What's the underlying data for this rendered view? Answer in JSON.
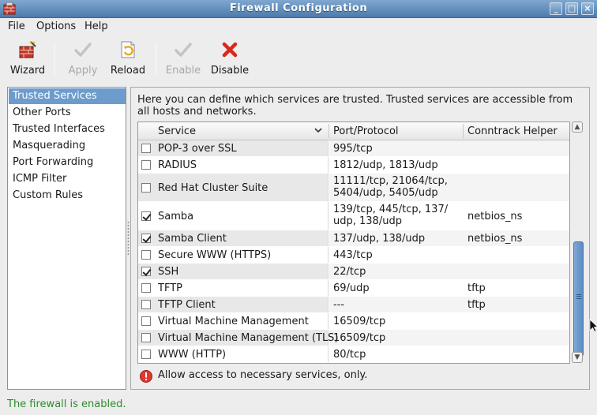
{
  "window": {
    "title": "Firewall Configuration"
  },
  "menu": [
    "File",
    "Options",
    "Help"
  ],
  "toolbar": [
    {
      "label": "Wizard",
      "icon": "wizard-icon",
      "enabled": true
    },
    {
      "label": "Apply",
      "icon": "checkmark-icon",
      "enabled": false
    },
    {
      "label": "Reload",
      "icon": "reload-icon",
      "enabled": true
    },
    {
      "label": "Enable",
      "icon": "checkmark-icon",
      "enabled": false
    },
    {
      "label": "Disable",
      "icon": "red-x-icon",
      "enabled": true
    }
  ],
  "sidebar": {
    "selected": "Trusted Services",
    "items": [
      "Trusted Services",
      "Other Ports",
      "Trusted Interfaces",
      "Masquerading",
      "Port Forwarding",
      "ICMP Filter",
      "Custom Rules"
    ]
  },
  "main": {
    "description": "Here you can define which services are trusted. Trusted services are accessible from all hosts and networks.",
    "columns": [
      "Service",
      "Port/Protocol",
      "Conntrack Helper"
    ],
    "rows": [
      {
        "checked": false,
        "service": "POP-3 over SSL",
        "ports": "995/tcp",
        "helper": ""
      },
      {
        "checked": false,
        "service": "RADIUS",
        "ports": "1812/udp, 1813/udp",
        "helper": ""
      },
      {
        "checked": false,
        "service": "Red Hat Cluster Suite",
        "ports": "11111/tcp, 21064/tcp, 5404/udp, 5405/udp",
        "helper": ""
      },
      {
        "checked": true,
        "service": "Samba",
        "ports": "139/tcp, 445/tcp, 137/ udp, 138/udp",
        "helper": "netbios_ns"
      },
      {
        "checked": true,
        "service": "Samba Client",
        "ports": "137/udp, 138/udp",
        "helper": "netbios_ns"
      },
      {
        "checked": false,
        "service": "Secure WWW (HTTPS)",
        "ports": "443/tcp",
        "helper": ""
      },
      {
        "checked": true,
        "service": "SSH",
        "ports": "22/tcp",
        "helper": ""
      },
      {
        "checked": false,
        "service": "TFTP",
        "ports": "69/udp",
        "helper": "tftp"
      },
      {
        "checked": false,
        "service": "TFTP Client",
        "ports": "---",
        "helper": "tftp"
      },
      {
        "checked": false,
        "service": "Virtual Machine Management",
        "ports": "16509/tcp",
        "helper": ""
      },
      {
        "checked": false,
        "service": "Virtual Machine Management (TLS)",
        "ports": "16509/tcp",
        "helper": ""
      },
      {
        "checked": false,
        "service": "WWW (HTTP)",
        "ports": "80/tcp",
        "helper": ""
      }
    ],
    "warning": "Allow access to necessary services, only."
  },
  "status": {
    "text": "The firewall is enabled.",
    "color": "#2e8b2e"
  },
  "colors": {
    "selection": "#6d9ccc",
    "titlebar": "#5a86b6",
    "error": "#e03a2e"
  }
}
